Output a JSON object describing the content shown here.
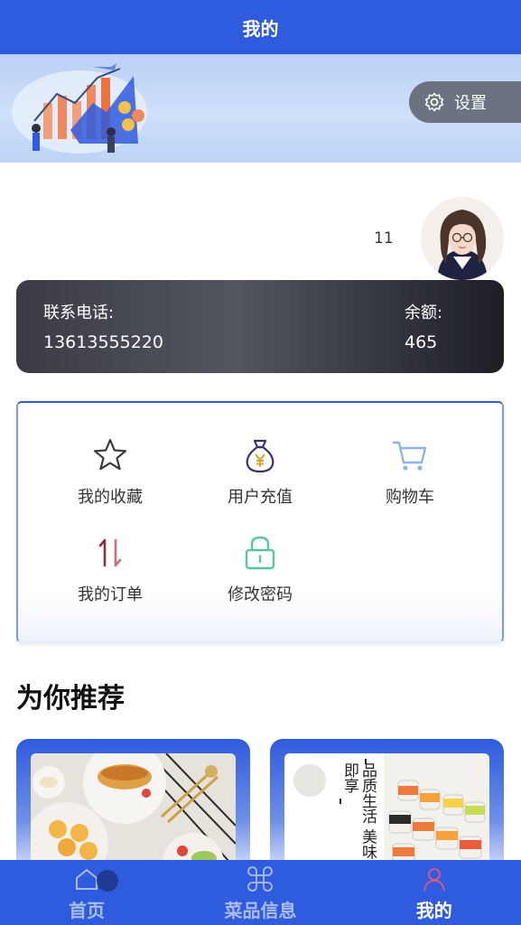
{
  "header": {
    "title": "我的"
  },
  "settings": {
    "label": "设置",
    "icon": "gear-icon"
  },
  "profile": {
    "username": "11"
  },
  "account": {
    "phone_label": "联系电话:",
    "phone_value": "13613555220",
    "balance_label": "余额:",
    "balance_value": "465"
  },
  "menu": {
    "favorites": "我的收藏",
    "recharge": "用户充值",
    "cart": "购物车",
    "orders": "我的订单",
    "change_password": "修改密码"
  },
  "recommend": {
    "title": "为你推荐",
    "poster_text": "品质生活 美味即享"
  },
  "tabbar": {
    "home": "首页",
    "dishes": "菜品信息",
    "mine": "我的"
  },
  "colors": {
    "primary": "#2f5bde",
    "tab_inactive": "#a9bdf2",
    "tab_active": "#ffffff"
  }
}
